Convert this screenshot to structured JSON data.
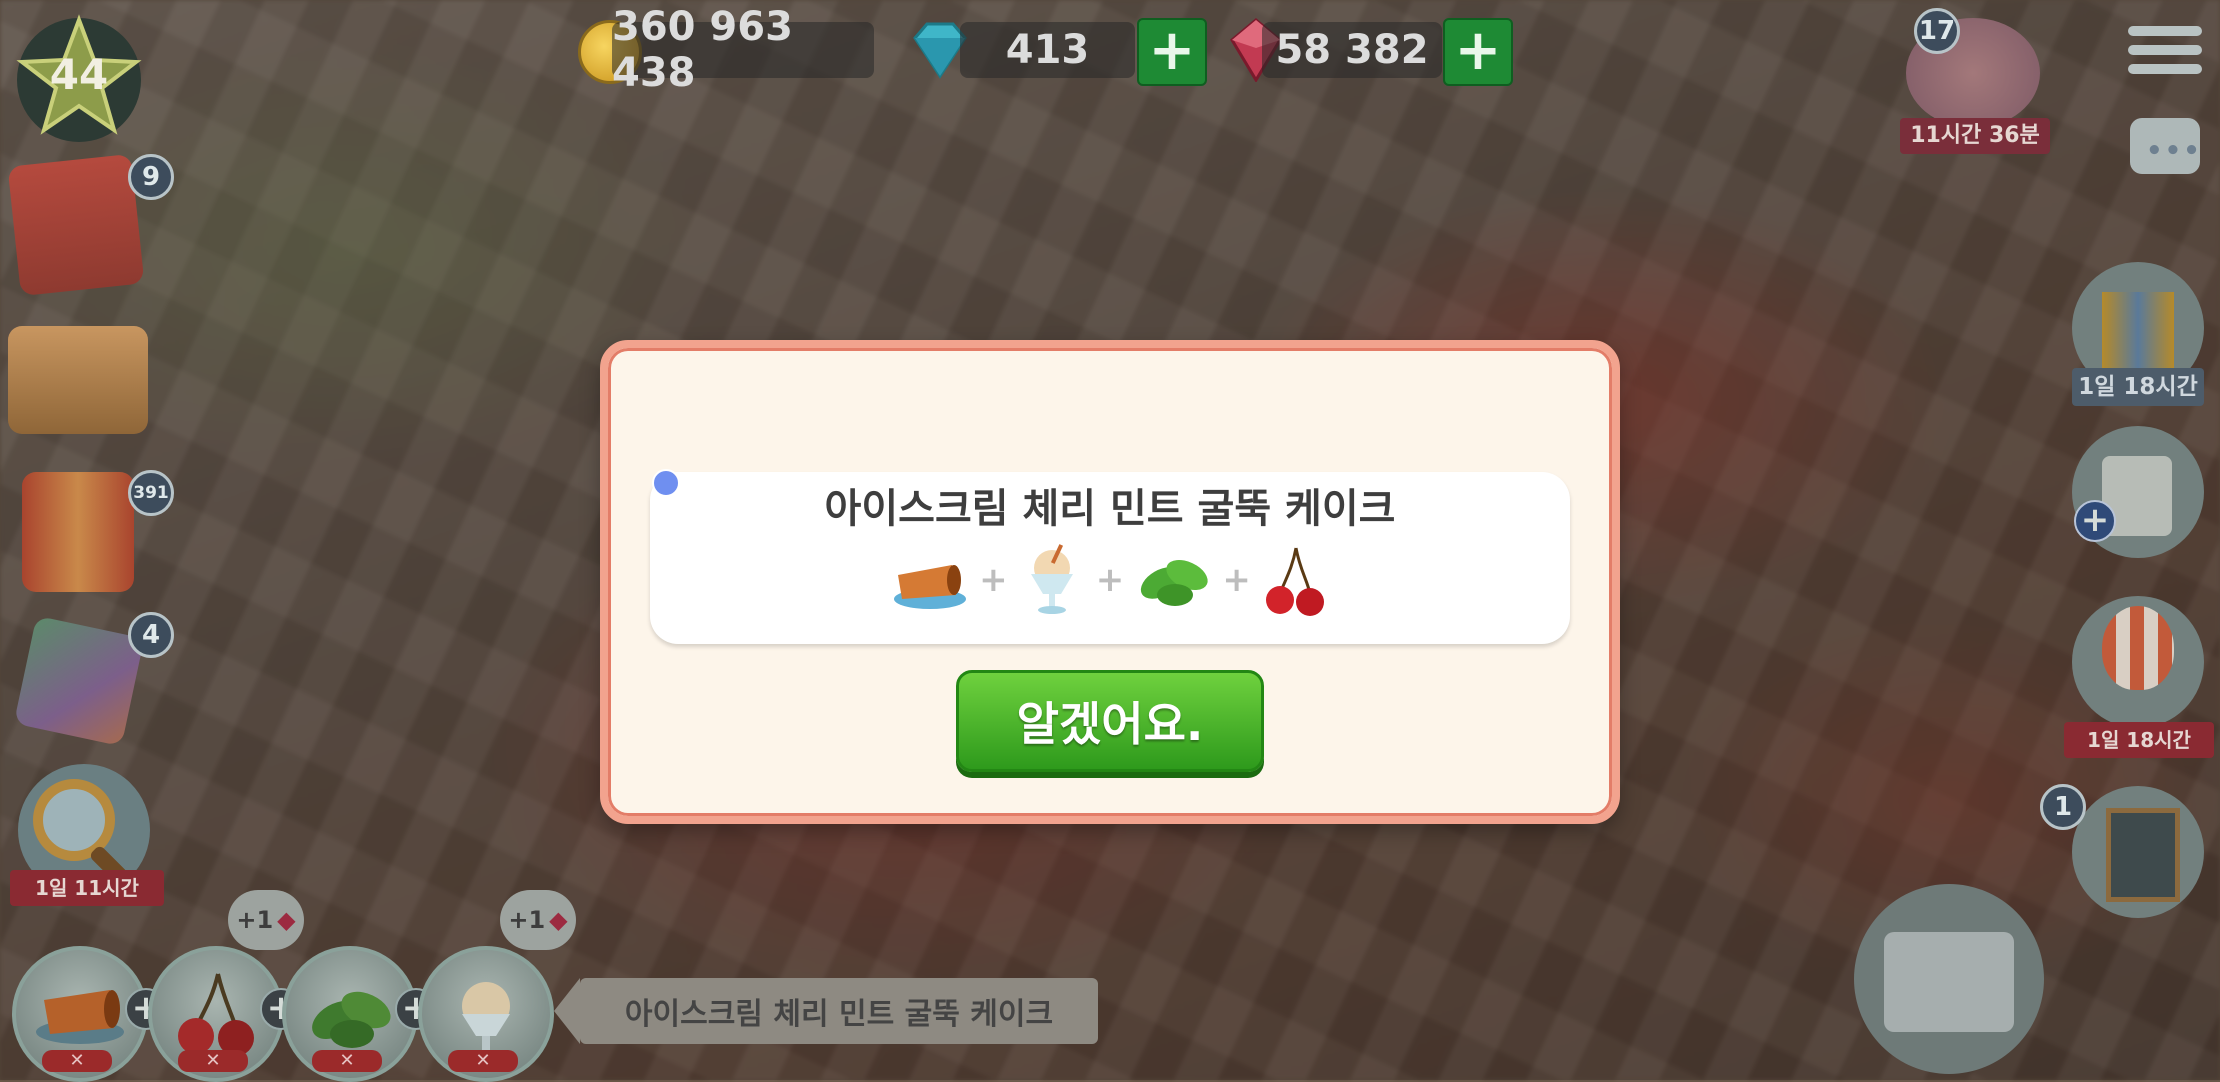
{
  "currency": {
    "coins": "360 963 438",
    "gems": "413",
    "rubies": "58 382"
  },
  "player": {
    "level": "44"
  },
  "left_badges": {
    "orders_count": "9",
    "gifts_count": "391",
    "gems_count": "4"
  },
  "left_timers": {
    "search_timer": "1일 11시간"
  },
  "right_panel": {
    "event_count": "17",
    "event_timer": "11시간 36분",
    "gift_timer": "1일 18시간",
    "balloon_timer": "1일 18시간",
    "board_count": "1"
  },
  "bottom_bar": {
    "bonus_1": "+1",
    "bonus_2": "+1",
    "recipe_name": "아이스크림 체리 민트 굴뚝 케이크",
    "ingredients": [
      "chimney-cake",
      "cherry",
      "mint",
      "ice-cream"
    ]
  },
  "dialog": {
    "recipe_title": "아이스크림 체리 민트 굴뚝 케이크",
    "ingredients": [
      "chimney-cake",
      "ice-cream",
      "mint",
      "cherry"
    ],
    "ok_label": "알겠어요."
  },
  "colors": {
    "dialog_border": "#f2a38e",
    "dialog_bg": "#fdf5ea",
    "ok_button": "#4cb82c",
    "plus_button": "#1e8a34"
  }
}
